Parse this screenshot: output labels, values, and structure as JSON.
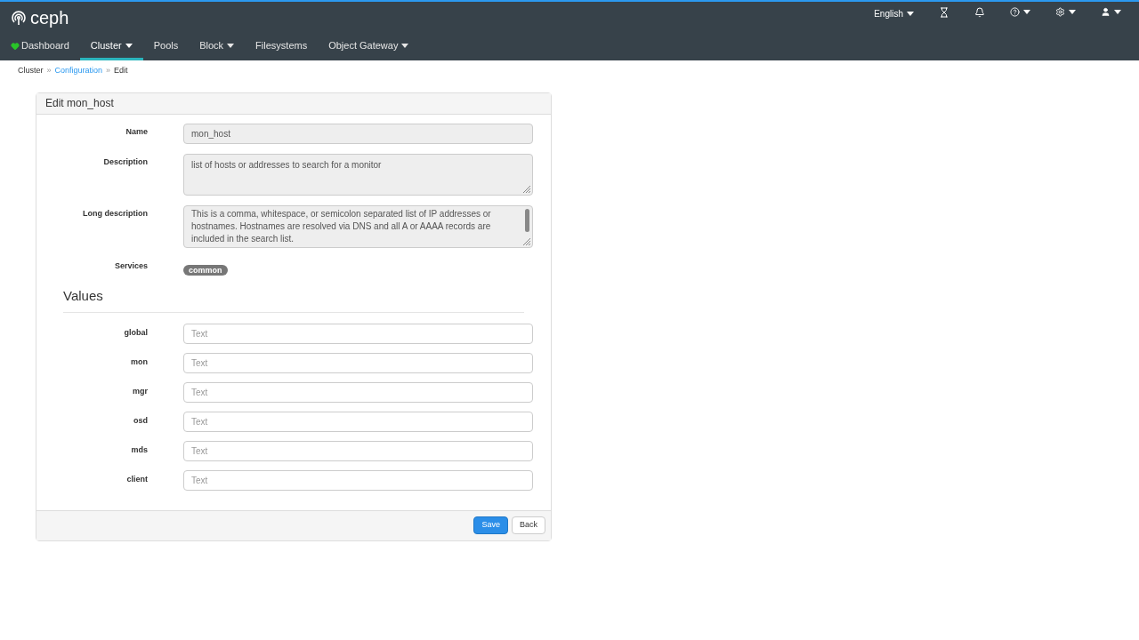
{
  "brand": {
    "name": "ceph"
  },
  "header": {
    "language": "English"
  },
  "nav": [
    {
      "label": "Dashboard",
      "kind": "dashboard",
      "dropdown": false,
      "selected": false
    },
    {
      "label": "Cluster",
      "kind": "plain",
      "dropdown": true,
      "selected": true
    },
    {
      "label": "Pools",
      "kind": "plain",
      "dropdown": false,
      "selected": false
    },
    {
      "label": "Block",
      "kind": "plain",
      "dropdown": true,
      "selected": false
    },
    {
      "label": "Filesystems",
      "kind": "plain",
      "dropdown": false,
      "selected": false
    },
    {
      "label": "Object Gateway",
      "kind": "plain",
      "dropdown": true,
      "selected": false
    }
  ],
  "breadcrumb_separator": "»",
  "breadcrumb": [
    {
      "label": "Cluster",
      "link": false
    },
    {
      "label": "Configuration",
      "link": true
    },
    {
      "label": "Edit",
      "link": false
    }
  ],
  "panel": {
    "title": "Edit mon_host",
    "fields": [
      {
        "label": "Name",
        "kind": "input",
        "value": "mon_host"
      },
      {
        "label": "Description",
        "kind": "textarea",
        "value": "list of hosts or addresses to search for a monitor"
      },
      {
        "label": "Long description",
        "kind": "textarea-scroll",
        "value": "This is a comma, whitespace, or semicolon separated list of IP addresses or hostnames. Hostnames are resolved via DNS and all A or AAAA records are included in the search list."
      },
      {
        "label": "Services",
        "kind": "badges",
        "badges": [
          "common"
        ]
      }
    ],
    "values_heading": "Values",
    "values": [
      {
        "label": "global",
        "placeholder": "Text"
      },
      {
        "label": "mon",
        "placeholder": "Text"
      },
      {
        "label": "mgr",
        "placeholder": "Text"
      },
      {
        "label": "osd",
        "placeholder": "Text"
      },
      {
        "label": "mds",
        "placeholder": "Text"
      },
      {
        "label": "client",
        "placeholder": "Text"
      }
    ],
    "buttons": [
      {
        "label": "Save",
        "kind": "primary"
      },
      {
        "label": "Back",
        "kind": "default"
      }
    ]
  }
}
